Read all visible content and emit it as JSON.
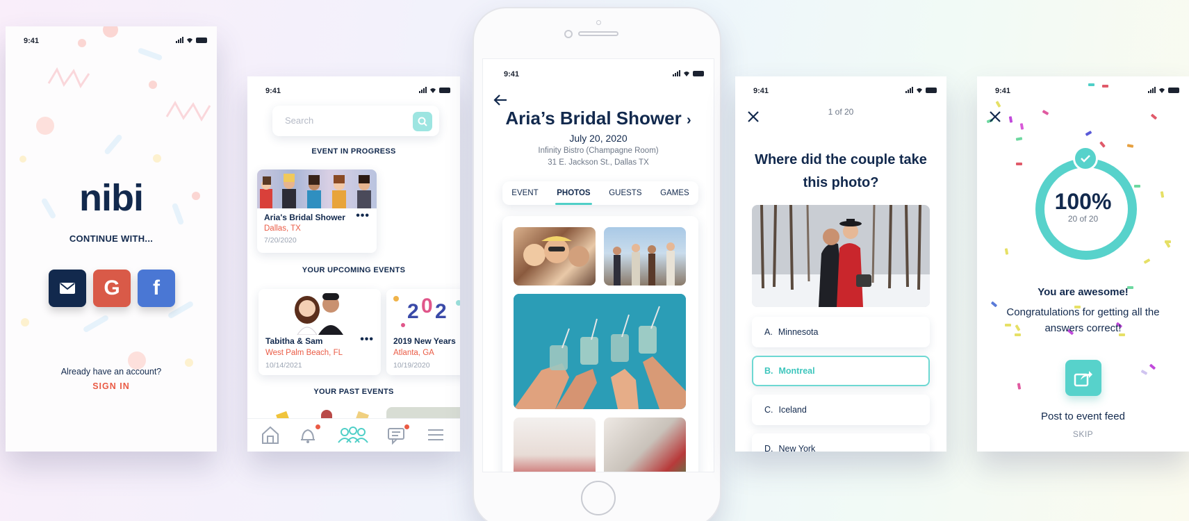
{
  "status_time": "9:41",
  "login": {
    "logo": "nibi",
    "continue_label": "CONTINUE WITH...",
    "social": [
      {
        "icon": "mail-icon",
        "glyph": "✉",
        "color": "#12294d"
      },
      {
        "icon": "google-icon",
        "glyph": "G",
        "color": "#d95a48"
      },
      {
        "icon": "facebook-icon",
        "glyph": "f",
        "color": "#4a77d4"
      }
    ],
    "already_label": "Already have an account?",
    "signin_label": "SIGN IN"
  },
  "events": {
    "search_placeholder": "Search",
    "in_progress_title": "EVENT IN PROGRESS",
    "upcoming_title": "YOUR UPCOMING EVENTS",
    "past_title": "YOUR PAST EVENTS",
    "in_progress": {
      "name": "Aria's Bridal Shower",
      "location": "Dallas, TX",
      "date": "7/20/2020"
    },
    "upcoming": [
      {
        "name": "Tabitha & Sam",
        "location": "West Palm Beach, FL",
        "date": "10/14/2021"
      },
      {
        "name": "2019 New Years",
        "location": "Atlanta, GA",
        "date": "10/19/2020"
      }
    ],
    "more_label": "•••",
    "tabbar": [
      "home-icon",
      "bell-icon",
      "guests-icon",
      "chat-icon",
      "menu-icon"
    ]
  },
  "event_detail": {
    "title": "Aria’s Bridal Shower",
    "chevron": "›",
    "date": "July 20, 2020",
    "venue": "Infinity Bistro (Champagne Room)",
    "address": "31 E. Jackson St., Dallas TX",
    "tabs": [
      "EVENT",
      "PHOTOS",
      "GUESTS",
      "GAMES"
    ],
    "active_tab": "PHOTOS"
  },
  "quiz": {
    "counter": "1 of 20",
    "question": "Where did the couple take this photo?",
    "answers": [
      {
        "letter": "A.",
        "text": "Minnesota"
      },
      {
        "letter": "B.",
        "text": "Montreal"
      },
      {
        "letter": "C.",
        "text": "Iceland"
      },
      {
        "letter": "D.",
        "text": "New York"
      }
    ],
    "selected": "Montreal"
  },
  "result": {
    "percent": "100%",
    "score": "20 of 20",
    "title": "You are awesome!",
    "message": "Congratulations for getting all the answers correct!",
    "post_label": "Post to event feed",
    "skip_label": "SKIP"
  },
  "colors": {
    "navy": "#12294d",
    "coral": "#ea5b45",
    "teal": "#57d2cb"
  }
}
